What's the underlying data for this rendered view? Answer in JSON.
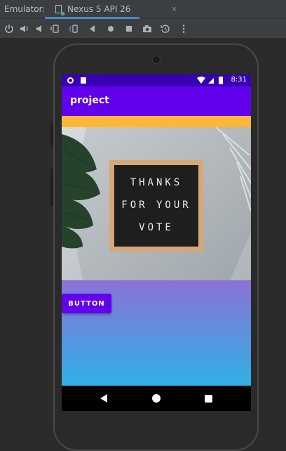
{
  "emulator": {
    "label": "Emulator:",
    "tab_title": "Nexus 5 API 26",
    "tab_close": "×",
    "toolbar_icons": [
      "power-icon",
      "volume-up-icon",
      "volume-down-icon",
      "rotate-left-icon",
      "rotate-right-icon",
      "back-icon",
      "home-icon",
      "overview-icon",
      "screenshot-icon",
      "snapshot-icon",
      "more-icon"
    ]
  },
  "device": {
    "status_bar": {
      "time": "8:31"
    },
    "app_bar": {
      "title": "project"
    },
    "image": {
      "sign_lines": [
        "THANKS",
        "FOR YOUR",
        "VOTE"
      ]
    },
    "button": {
      "label": "BUTTON"
    }
  },
  "colors": {
    "status_bar": "#3700b3",
    "primary": "#6200ee",
    "strip": "#ffb638",
    "gradient_top": "#8b71d6",
    "gradient_bottom": "#2fb0e6"
  }
}
